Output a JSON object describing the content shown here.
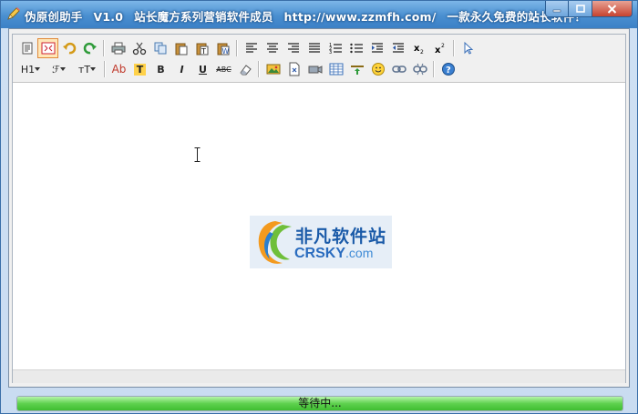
{
  "titlebar": {
    "app_name": "伪原创助手",
    "version": "V1.0",
    "series": "站长魔方系列营销软件成员",
    "url": "http://www.zzmfh.com/",
    "slogan": "一款永久免费的站长软件！"
  },
  "toolbar": {
    "row1": [
      "source-icon",
      "fullscreen-icon",
      "undo-icon",
      "redo-icon",
      "print-icon",
      "cut-icon",
      "copy-icon",
      "paste-icon",
      "paste-text-icon",
      "paste-word-icon",
      "align-left-icon",
      "align-center-icon",
      "align-right-icon",
      "justify-icon",
      "ordered-list-icon",
      "unordered-list-icon",
      "indent-icon",
      "outdent-icon",
      "subscript-icon",
      "superscript-icon",
      "select-all-icon"
    ],
    "row2": {
      "heading_label": "H1",
      "font_label": "ℱ",
      "size_label": "тT",
      "font_color_label": "Ab",
      "highlight_label": "T",
      "bold_label": "B",
      "italic_label": "I",
      "underline_label": "U",
      "strike_label": "ABC"
    }
  },
  "watermark": {
    "cn_text": "非凡软件站",
    "en_text": "CRSKY",
    "en_suffix": ".com"
  },
  "status": {
    "text": "等待中...",
    "progress": 1.0
  },
  "colors": {
    "titlebar": "#4a8fd0",
    "progress": "#5fd14f"
  }
}
